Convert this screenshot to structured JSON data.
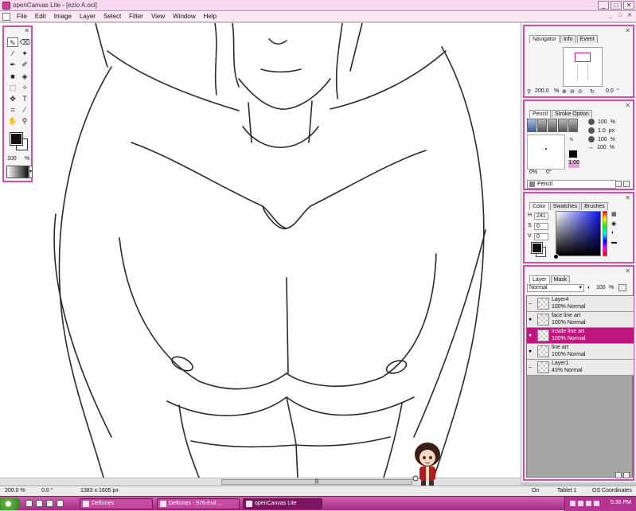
{
  "window": {
    "title": "openCanvas Lite - [ezio A.oci]",
    "controls": [
      "_",
      "□",
      "✕"
    ]
  },
  "menu": {
    "items": [
      "File",
      "Edit",
      "Image",
      "Layer",
      "Select",
      "Filter",
      "View",
      "Window",
      "Help"
    ],
    "mdi_controls": [
      "_",
      "□",
      "✕"
    ]
  },
  "toolbox": {
    "close": "✕",
    "opacity": "100",
    "opacity_unit": "%",
    "fg_color": "#140e12",
    "bg_color": "#ffffff"
  },
  "navigator": {
    "close": "✕",
    "tabs": [
      "Navigator",
      "Info",
      "Event"
    ],
    "zoom": "200.0",
    "zoom_unit": "%",
    "rotation": "0.0",
    "rotation_unit": "°"
  },
  "pencil_panel": {
    "close": "✕",
    "tabs": [
      "Pencil",
      "Stroke Option"
    ],
    "density": "100",
    "density_unit": "%",
    "size": "1.0",
    "size_unit": "px",
    "blend": "100",
    "blend_unit": "%",
    "stretch": "100",
    "stretch_unit": "%",
    "angle_pct": "0%",
    "angle_deg": "0°",
    "ratio": "1.00",
    "brush_name": "Pencil"
  },
  "color_panel": {
    "close": "✕",
    "tabs": [
      "Color",
      "Swatches",
      "Brushes"
    ],
    "h_label": "H",
    "h_value": "241",
    "s_label": "S",
    "s_value": "0",
    "v_label": "V",
    "v_value": "0",
    "fg_color": "#140e12",
    "bg_color": "#ffffff"
  },
  "layer_panel": {
    "close": "✕",
    "tabs": [
      "Layer",
      "Mask"
    ],
    "blend_mode": "Normal",
    "opacity": "100",
    "opacity_unit": "%",
    "layers": [
      {
        "name": "Layer4",
        "props": "100% Normal",
        "visible": false,
        "selected": false
      },
      {
        "name": "face line art",
        "props": "100% Normal",
        "visible": true,
        "selected": false
      },
      {
        "name": "inside line art",
        "props": "100% Normal",
        "visible": true,
        "selected": true
      },
      {
        "name": "line art",
        "props": "100% Normal",
        "visible": true,
        "selected": false
      },
      {
        "name": "Layer1",
        "props": "43% Normal",
        "visible": false,
        "selected": false
      }
    ]
  },
  "status": {
    "zoom": "200.0 %",
    "rotation": "0.0 °",
    "size": "1383 x 1605 px",
    "state": "On",
    "tablet": "Tablet 1",
    "coords": "OS Coordinates"
  },
  "taskbar": {
    "tasks": [
      {
        "label": "Deftones",
        "active": false
      },
      {
        "label": "Deftones - 976-Evil ...",
        "active": false
      },
      {
        "label": "openCanvas Lite",
        "active": true
      }
    ],
    "time": "5:36 PM"
  },
  "scroll": {
    "grip": "|||"
  }
}
